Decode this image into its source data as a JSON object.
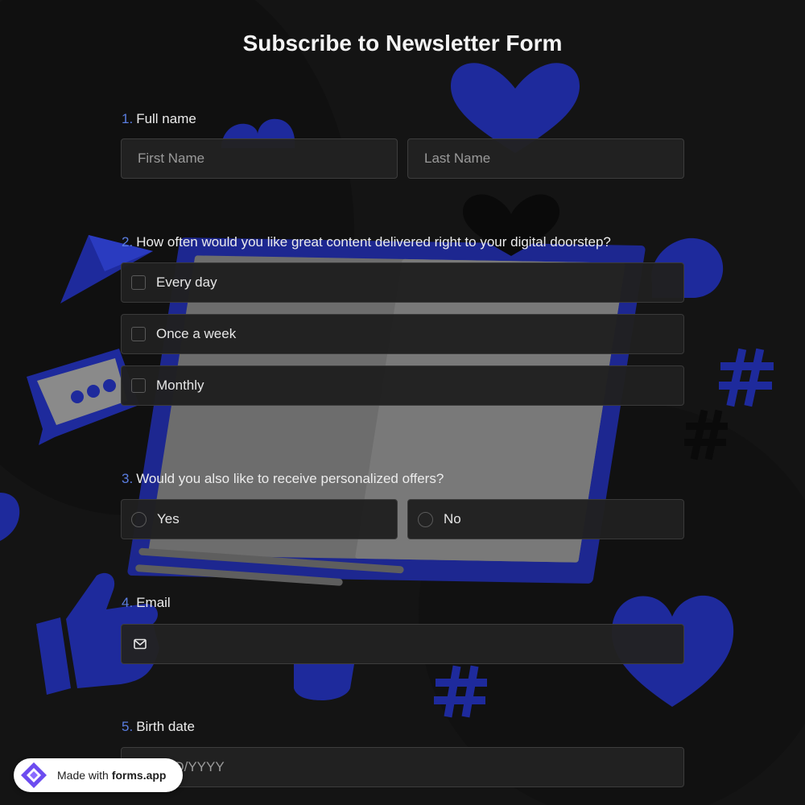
{
  "form": {
    "title": "Subscribe to Newsletter Form"
  },
  "questions": {
    "full_name": {
      "number": "1.",
      "label": "Full name",
      "first_placeholder": "First Name",
      "last_placeholder": "Last Name"
    },
    "frequency": {
      "number": "2.",
      "label": "How often would you like great content delivered right to your digital doorstep?",
      "options": [
        "Every day",
        "Once a week",
        "Monthly"
      ]
    },
    "offers": {
      "number": "3.",
      "label": "Would you also like to receive personalized offers?",
      "options": [
        "Yes",
        "No"
      ]
    },
    "email": {
      "number": "4.",
      "label": "Email",
      "icon": "mail-icon",
      "value": ""
    },
    "birth_date": {
      "number": "5.",
      "label": "Birth date",
      "placeholder": "MM/DD/YYYY"
    }
  },
  "badge": {
    "made_with": "Made with",
    "brand": "forms.app"
  },
  "colors": {
    "accent": "#5a7de0",
    "background": "#141414",
    "field": "#222222",
    "decor_blue": "#1d2790"
  }
}
